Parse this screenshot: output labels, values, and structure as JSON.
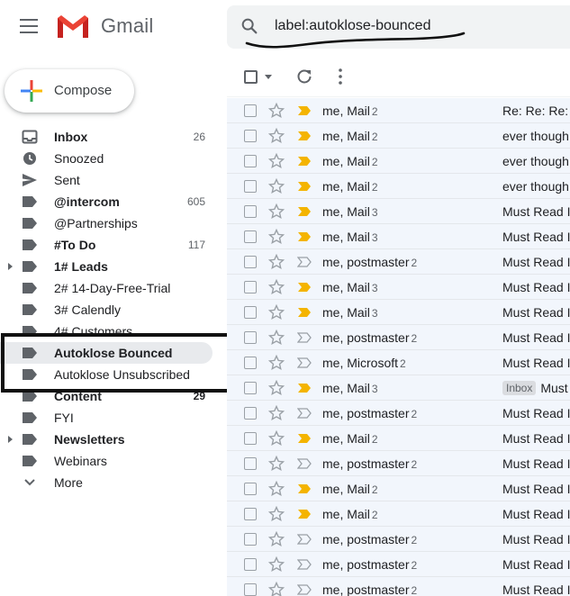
{
  "app": {
    "name": "Gmail",
    "brand_red": "#ea4335"
  },
  "search": {
    "value": "label:autoklose-bounced"
  },
  "compose": {
    "label": "Compose"
  },
  "sidebar": {
    "items": [
      {
        "label": "Inbox",
        "count": "26",
        "bold": true,
        "icon": "inbox-icon",
        "name": "inbox"
      },
      {
        "label": "Snoozed",
        "count": "",
        "bold": false,
        "icon": "clock-icon",
        "name": "snoozed"
      },
      {
        "label": "Sent",
        "count": "",
        "bold": false,
        "icon": "send-icon",
        "name": "sent"
      },
      {
        "label": "@intercom",
        "count": "605",
        "bold": true,
        "icon": "label-icon",
        "name": "intercom"
      },
      {
        "label": "@Partnerships",
        "count": "",
        "bold": false,
        "icon": "label-icon",
        "name": "partnerships"
      },
      {
        "label": "#To Do",
        "count": "117",
        "bold": true,
        "icon": "label-icon",
        "name": "to-do"
      },
      {
        "label": "1# Leads",
        "count": "",
        "bold": true,
        "icon": "label-icon",
        "name": "leads",
        "expandable": true
      },
      {
        "label": "2# 14-Day-Free-Trial",
        "count": "",
        "bold": false,
        "icon": "label-icon",
        "name": "free-trial"
      },
      {
        "label": "3# Calendly",
        "count": "",
        "bold": false,
        "icon": "label-icon",
        "name": "calendly"
      },
      {
        "label": "4# Customers",
        "count": "",
        "bold": false,
        "icon": "label-icon",
        "name": "customers"
      },
      {
        "label": "Autoklose Bounced",
        "count": "",
        "bold": true,
        "icon": "label-icon",
        "name": "autoklose-bounced",
        "active": true
      },
      {
        "label": "Autoklose Unsubscribed",
        "count": "",
        "bold": false,
        "icon": "label-icon",
        "name": "autoklose-unsubscribed"
      },
      {
        "label": "Content",
        "count": "29",
        "bold": true,
        "icon": "label-icon",
        "name": "content"
      },
      {
        "label": "FYI",
        "count": "",
        "bold": false,
        "icon": "label-icon",
        "name": "fyi"
      },
      {
        "label": "Newsletters",
        "count": "",
        "bold": true,
        "icon": "label-icon",
        "name": "newsletters",
        "expandable": true
      },
      {
        "label": "Webinars",
        "count": "",
        "bold": false,
        "icon": "label-icon",
        "name": "webinars"
      },
      {
        "label": "More",
        "count": "",
        "bold": false,
        "icon": "chevron-down-icon",
        "name": "more"
      }
    ]
  },
  "mails": [
    {
      "sender": "me, Mail",
      "count": "2",
      "important": true,
      "badge": "",
      "subject": "Re: Re: Re: e"
    },
    {
      "sender": "me, Mail",
      "count": "2",
      "important": true,
      "badge": "",
      "subject": "ever though"
    },
    {
      "sender": "me, Mail",
      "count": "2",
      "important": true,
      "badge": "",
      "subject": "ever though"
    },
    {
      "sender": "me, Mail",
      "count": "2",
      "important": true,
      "badge": "",
      "subject": "ever though"
    },
    {
      "sender": "me, Mail",
      "count": "3",
      "important": true,
      "badge": "",
      "subject": "Must Read I"
    },
    {
      "sender": "me, Mail",
      "count": "3",
      "important": true,
      "badge": "",
      "subject": "Must Read I"
    },
    {
      "sender": "me, postmaster",
      "count": "2",
      "important": false,
      "badge": "",
      "subject": "Must Read I"
    },
    {
      "sender": "me, Mail",
      "count": "3",
      "important": true,
      "badge": "",
      "subject": "Must Read I"
    },
    {
      "sender": "me, Mail",
      "count": "3",
      "important": true,
      "badge": "",
      "subject": "Must Read I"
    },
    {
      "sender": "me, postmaster",
      "count": "2",
      "important": false,
      "badge": "",
      "subject": "Must Read I"
    },
    {
      "sender": "me, Microsoft",
      "count": "2",
      "important": false,
      "badge": "",
      "subject": "Must Read I"
    },
    {
      "sender": "me, Mail",
      "count": "3",
      "important": true,
      "badge": "Inbox",
      "subject": "Must"
    },
    {
      "sender": "me, postmaster",
      "count": "2",
      "important": false,
      "badge": "",
      "subject": "Must Read I"
    },
    {
      "sender": "me, Mail",
      "count": "2",
      "important": true,
      "badge": "",
      "subject": "Must Read I"
    },
    {
      "sender": "me, postmaster",
      "count": "2",
      "important": false,
      "badge": "",
      "subject": "Must Read I"
    },
    {
      "sender": "me, Mail",
      "count": "2",
      "important": true,
      "badge": "",
      "subject": "Must Read I"
    },
    {
      "sender": "me, Mail",
      "count": "2",
      "important": true,
      "badge": "",
      "subject": "Must Read I"
    },
    {
      "sender": "me, postmaster",
      "count": "2",
      "important": false,
      "badge": "",
      "subject": "Must Read I"
    },
    {
      "sender": "me, postmaster",
      "count": "2",
      "important": false,
      "badge": "",
      "subject": "Must Read I"
    },
    {
      "sender": "me, postmaster",
      "count": "2",
      "important": false,
      "badge": "",
      "subject": "Must Read I"
    }
  ],
  "colors": {
    "important": "#f4b400",
    "selected_row": "#f2f6fc",
    "annotation_box": "#111111"
  }
}
